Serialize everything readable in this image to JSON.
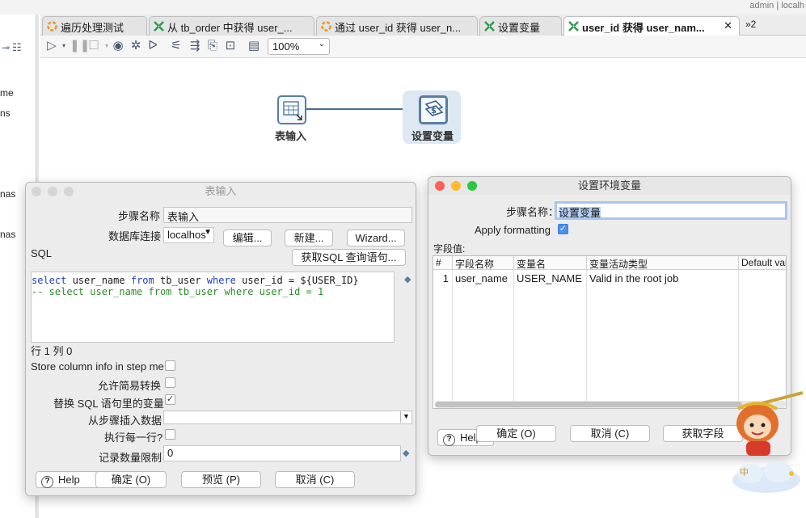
{
  "userbar": {
    "text": "admin  |  localh"
  },
  "left_panel": {
    "labels": [
      "me",
      "ns",
      "nas",
      "nas"
    ]
  },
  "tabs": [
    {
      "label": "遍历处理测试",
      "icon": "transformation-orange-icon"
    },
    {
      "label": "从 tb_order 中获得 user_...",
      "icon": "transformation-green-icon"
    },
    {
      "label": "通过 user_id 获得 user_n...",
      "icon": "transformation-orange-icon"
    },
    {
      "label": "设置变量",
      "icon": "transformation-green-icon"
    },
    {
      "label": "user_id 获得 user_nam...",
      "icon": "transformation-green-icon",
      "active": true,
      "close": "✕"
    },
    {
      "label": "»2",
      "icon": "overflow-icon"
    }
  ],
  "toolbar": {
    "icons": [
      "run-icon",
      "pause-icon",
      "stop-icon",
      "preview-icon",
      "debug-icon",
      "replay-icon",
      "verify-icon",
      "impact-icon",
      "sql-icon",
      "explore-db-icon",
      "show-results-icon"
    ],
    "zoom": "100%"
  },
  "canvas": {
    "steps": [
      {
        "label": "表输入",
        "icon": "table-input-icon"
      },
      {
        "label": "设置变量",
        "icon": "set-variables-icon"
      }
    ]
  },
  "table_input_dialog": {
    "title": "表输入",
    "step_name_label": "步骤名称",
    "step_name_value": "表输入",
    "db_connection_label": "数据库连接",
    "db_connection_value": "localhos",
    "edit_button": "编辑...",
    "new_button": "新建...",
    "wizard_button": "Wizard...",
    "sql_label": "SQL",
    "get_sql_button": "获取SQL 查询语句...",
    "sql_line1": "select user_name from tb_user where user_id = ${USER_ID}",
    "sql_line2": "-- select user_name from tb_user where user_id = 1",
    "position_text": "行 1 列 0",
    "store_column_info_label": "Store column info in step me",
    "store_column_info": false,
    "lazy_conversion_label": "允许简易转换",
    "lazy_conversion": false,
    "replace_variables_label": "替换 SQL 语句里的变量",
    "replace_variables": true,
    "insert_data_from_step_label": "从步骤插入数据",
    "insert_data_from_step_value": "",
    "execute_each_row_label": "执行每一行?",
    "execute_each_row": false,
    "limit_label": "记录数量限制",
    "limit_value": "0",
    "help_button": "Help",
    "ok_button": "确定 (O)",
    "preview_button": "预览 (P)",
    "cancel_button": "取消 (C)"
  },
  "set_env_dialog": {
    "title": "设置环境变量",
    "step_name_label": "步骤名称：",
    "step_name_value": "设置变量",
    "apply_formatting_label": "Apply formatting",
    "apply_formatting": true,
    "field_values_label": "字段值:",
    "columns": [
      "#",
      "字段名称",
      "变量名",
      "变量活动类型",
      "Default val"
    ],
    "rows": [
      [
        "1",
        "user_name",
        "USER_NAME",
        "Valid in the root job",
        ""
      ]
    ],
    "help_button": "Help",
    "ok_button": "确定 (O)",
    "cancel_button": "取消 (C)",
    "get_fields_button": "获取字段"
  },
  "colors": {
    "accent_blue": "#4b8ef1",
    "hop_color": "#4a6a90",
    "sql_keyword": "#1c3ec8",
    "sql_comment": "#2e8b2e"
  }
}
